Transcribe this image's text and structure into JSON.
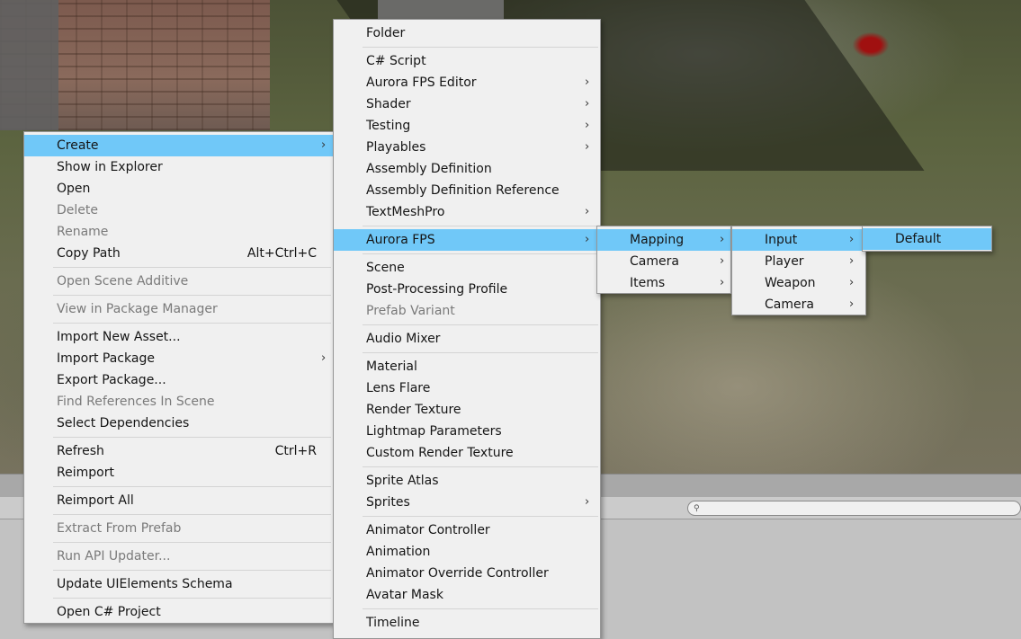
{
  "context_menu": {
    "items": [
      {
        "label": "Create",
        "submenu": true,
        "highlighted": true
      },
      {
        "label": "Show in Explorer"
      },
      {
        "label": "Open"
      },
      {
        "label": "Delete",
        "disabled": true
      },
      {
        "label": "Rename",
        "disabled": true
      },
      {
        "label": "Copy Path",
        "shortcut": "Alt+Ctrl+C"
      },
      {
        "separator": true
      },
      {
        "label": "Open Scene Additive",
        "disabled": true
      },
      {
        "separator": true
      },
      {
        "label": "View in Package Manager",
        "disabled": true
      },
      {
        "separator": true
      },
      {
        "label": "Import New Asset..."
      },
      {
        "label": "Import Package",
        "submenu": true
      },
      {
        "label": "Export Package..."
      },
      {
        "label": "Find References In Scene",
        "disabled": true
      },
      {
        "label": "Select Dependencies"
      },
      {
        "separator": true
      },
      {
        "label": "Refresh",
        "shortcut": "Ctrl+R"
      },
      {
        "label": "Reimport"
      },
      {
        "separator": true
      },
      {
        "label": "Reimport All"
      },
      {
        "separator": true
      },
      {
        "label": "Extract From Prefab",
        "disabled": true
      },
      {
        "separator": true
      },
      {
        "label": "Run API Updater...",
        "disabled": true
      },
      {
        "separator": true
      },
      {
        "label": "Update UIElements Schema"
      },
      {
        "separator": true
      },
      {
        "label": "Open C# Project"
      }
    ]
  },
  "create_menu": {
    "items": [
      {
        "label": "Folder"
      },
      {
        "separator": true
      },
      {
        "label": "C# Script"
      },
      {
        "label": "Aurora FPS Editor",
        "submenu": true
      },
      {
        "label": "Shader",
        "submenu": true
      },
      {
        "label": "Testing",
        "submenu": true
      },
      {
        "label": "Playables",
        "submenu": true
      },
      {
        "label": "Assembly Definition"
      },
      {
        "label": "Assembly Definition Reference"
      },
      {
        "label": "TextMeshPro",
        "submenu": true
      },
      {
        "separator": true
      },
      {
        "label": "Aurora FPS",
        "submenu": true,
        "highlighted": true
      },
      {
        "separator": true
      },
      {
        "label": "Scene"
      },
      {
        "label": "Post-Processing Profile"
      },
      {
        "label": "Prefab Variant",
        "disabled": true
      },
      {
        "separator": true
      },
      {
        "label": "Audio Mixer"
      },
      {
        "separator": true
      },
      {
        "label": "Material"
      },
      {
        "label": "Lens Flare"
      },
      {
        "label": "Render Texture"
      },
      {
        "label": "Lightmap Parameters"
      },
      {
        "label": "Custom Render Texture"
      },
      {
        "separator": true
      },
      {
        "label": "Sprite Atlas"
      },
      {
        "label": "Sprites",
        "submenu": true
      },
      {
        "separator": true
      },
      {
        "label": "Animator Controller"
      },
      {
        "label": "Animation"
      },
      {
        "label": "Animator Override Controller"
      },
      {
        "label": "Avatar Mask"
      },
      {
        "separator": true
      },
      {
        "label": "Timeline"
      }
    ]
  },
  "aurora_fps_menu": {
    "items": [
      {
        "label": "Mapping",
        "submenu": true,
        "highlighted": true
      },
      {
        "label": "Camera",
        "submenu": true
      },
      {
        "label": "Items",
        "submenu": true
      }
    ]
  },
  "mapping_menu": {
    "items": [
      {
        "label": "Input",
        "submenu": true,
        "highlighted": true
      },
      {
        "label": "Player",
        "submenu": true
      },
      {
        "label": "Weapon",
        "submenu": true
      },
      {
        "label": "Camera",
        "submenu": true
      }
    ]
  },
  "input_menu": {
    "items": [
      {
        "label": "Default",
        "highlighted": true
      }
    ]
  },
  "icons": {
    "submenu_arrow": "chevron-right-icon",
    "search": "search-icon"
  },
  "colors": {
    "menu_background": "#f0f0f0",
    "highlight": "#70c8f8",
    "disabled_text": "#7a7a7a"
  }
}
